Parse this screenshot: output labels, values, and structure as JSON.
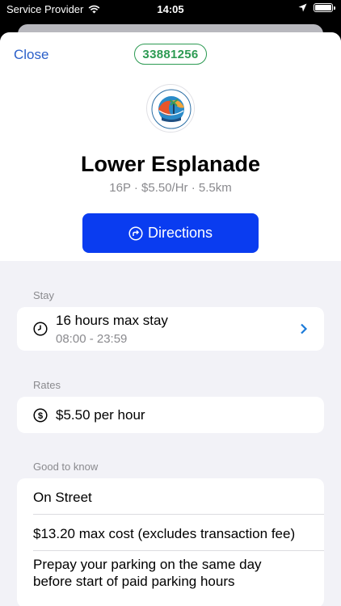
{
  "status_bar": {
    "carrier": "Service Provider",
    "time": "14:05"
  },
  "header": {
    "close_label": "Close",
    "zone_id": "33881256",
    "logo_text": "CITY OF PORT PHILLIP"
  },
  "location": {
    "name": "Lower Esplanade",
    "summary": "16P · $5.50/Hr · 5.5km",
    "directions_label": "Directions"
  },
  "stay": {
    "section_label": "Stay",
    "title": "16 hours max stay",
    "hours": "08:00 - 23:59",
    "icon": "clock-icon"
  },
  "rates": {
    "section_label": "Rates",
    "rate": "$5.50 per hour",
    "icon": "dollar-circle-icon"
  },
  "good_to_know": {
    "section_label": "Good to know",
    "items": [
      "On Street",
      "$13.20 max cost (excludes transaction fee)",
      "Prepay your parking on the same day before start of paid parking hours"
    ]
  },
  "colors": {
    "accent": "#0a3cf0",
    "link": "#2a5fc9",
    "badge": "#2c9a52",
    "chevron": "#1a7ad9"
  }
}
